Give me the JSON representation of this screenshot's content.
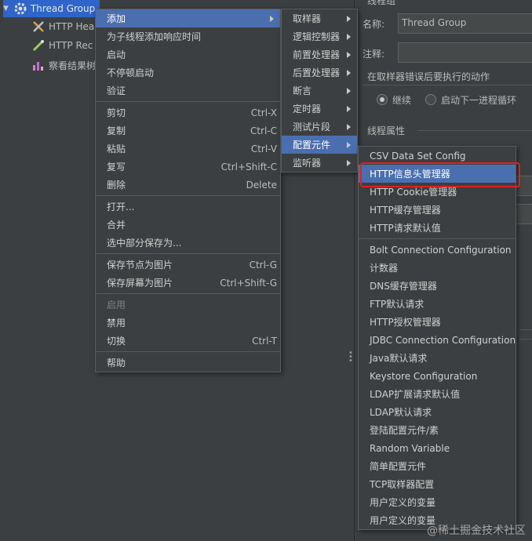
{
  "tree": {
    "items": [
      {
        "label": "Thread Group",
        "icon": "gear-icon"
      },
      {
        "label": "HTTP Hea",
        "icon": "tools-icon"
      },
      {
        "label": "HTTP Rec",
        "icon": "pipette-icon"
      },
      {
        "label": "察看结果树",
        "icon": "chart-icon"
      }
    ]
  },
  "props": {
    "header_label": "线程组",
    "name_label": "名称:",
    "name_value": "Thread Group",
    "comment_label": "注释:",
    "comment_value": "",
    "error_action_label": "在取样器错误后要执行的动作",
    "radio_continue": "继续",
    "radio_next_loop": "启动下一进程循环",
    "thread_props_label": "线程属性"
  },
  "menu1": {
    "items": [
      {
        "label": "添加",
        "shortcut": "",
        "submenu": true,
        "selected": true
      },
      {
        "label": "为子线程添加响应时间",
        "shortcut": ""
      },
      {
        "label": "启动",
        "shortcut": ""
      },
      {
        "label": "不停顿启动",
        "shortcut": ""
      },
      {
        "label": "验证",
        "shortcut": ""
      },
      {
        "sep": true
      },
      {
        "label": "剪切",
        "shortcut": "Ctrl-X"
      },
      {
        "label": "复制",
        "shortcut": "Ctrl-C"
      },
      {
        "label": "粘贴",
        "shortcut": "Ctrl-V"
      },
      {
        "label": "复写",
        "shortcut": "Ctrl+Shift-C"
      },
      {
        "label": "删除",
        "shortcut": "Delete"
      },
      {
        "sep": true
      },
      {
        "label": "打开...",
        "shortcut": ""
      },
      {
        "label": "合并",
        "shortcut": ""
      },
      {
        "label": "选中部分保存为...",
        "shortcut": ""
      },
      {
        "sep": true
      },
      {
        "label": "保存节点为图片",
        "shortcut": "Ctrl-G"
      },
      {
        "label": "保存屏幕为图片",
        "shortcut": "Ctrl+Shift-G"
      },
      {
        "sep": true
      },
      {
        "label": "启用",
        "shortcut": "",
        "disabled": true
      },
      {
        "label": "禁用",
        "shortcut": ""
      },
      {
        "label": "切换",
        "shortcut": "Ctrl-T"
      },
      {
        "sep": true
      },
      {
        "label": "帮助",
        "shortcut": ""
      }
    ]
  },
  "menu2": {
    "items": [
      {
        "label": "取样器",
        "submenu": true
      },
      {
        "label": "逻辑控制器",
        "submenu": true
      },
      {
        "label": "前置处理器",
        "submenu": true
      },
      {
        "label": "后置处理器",
        "submenu": true
      },
      {
        "label": "断言",
        "submenu": true
      },
      {
        "label": "定时器",
        "submenu": true
      },
      {
        "label": "测试片段",
        "submenu": true
      },
      {
        "label": "配置元件",
        "submenu": true,
        "selected": true
      },
      {
        "label": "监听器",
        "submenu": true
      }
    ]
  },
  "menu3": {
    "items": [
      {
        "label": "CSV Data Set Config"
      },
      {
        "label": "HTTP信息头管理器",
        "selected": true
      },
      {
        "label": "HTTP Cookie管理器"
      },
      {
        "label": "HTTP缓存管理器"
      },
      {
        "label": "HTTP请求默认值"
      },
      {
        "sep": true
      },
      {
        "label": "Bolt Connection Configuration"
      },
      {
        "label": "计数器"
      },
      {
        "label": "DNS缓存管理器"
      },
      {
        "label": "FTP默认请求"
      },
      {
        "label": "HTTP授权管理器"
      },
      {
        "label": "JDBC Connection Configuration"
      },
      {
        "label": "Java默认请求"
      },
      {
        "label": "Keystore Configuration"
      },
      {
        "label": "LDAP扩展请求默认值"
      },
      {
        "label": "LDAP默认请求"
      },
      {
        "label": "登陆配置元件/素"
      },
      {
        "label": "Random Variable"
      },
      {
        "label": "简单配置元件"
      },
      {
        "label": "TCP取样器配置"
      },
      {
        "label": "用户定义的变量"
      },
      {
        "label": "用户定义的变量"
      }
    ]
  },
  "watermark": "@稀土掘金技术社区",
  "colors": {
    "selection": "#4b6eaf",
    "highlight_box": "#e02020",
    "background": "#3c3f41"
  }
}
